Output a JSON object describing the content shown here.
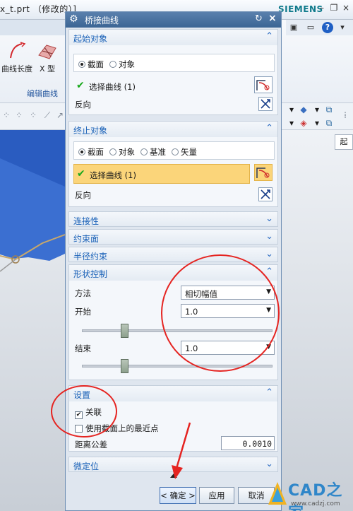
{
  "window": {
    "file_title": "x_t.prt （修改的）]",
    "brand": "SIEMENS",
    "minimize": "–",
    "restore": "❐",
    "close": "×"
  },
  "ribbon": {
    "tool1_label": "曲线长度",
    "tool2_label": "X 型",
    "group_label": "编辑曲线"
  },
  "side_tab_label": "起",
  "dialog": {
    "title": "桥接曲线",
    "start_section": {
      "title": "起始对象",
      "radio_options": [
        "截面",
        "对象"
      ],
      "radio_selected": "截面",
      "select_curve_label": "选择曲线 (1)",
      "reverse_label": "反向"
    },
    "end_section": {
      "title": "终止对象",
      "radio_options": [
        "截面",
        "对象",
        "基准",
        "矢量"
      ],
      "radio_selected": "截面",
      "select_curve_label": "选择曲线 (1)",
      "reverse_label": "反向"
    },
    "continuity_title": "连接性",
    "constraint_face_title": "约束面",
    "radius_constraint_title": "半径约束",
    "shape_control": {
      "title": "形状控制",
      "method_label": "方法",
      "method_value": "相切幅值",
      "start_label": "开始",
      "start_value": "1.0",
      "start_slider_fraction": 0.2,
      "end_label": "结束",
      "end_value": "1.0",
      "end_slider_fraction": 0.2
    },
    "settings": {
      "title": "设置",
      "associative_label": "关联",
      "associative_checked": true,
      "nearest_point_label": "使用截面上的最近点",
      "nearest_point_checked": false,
      "distance_tolerance_label": "距离公差",
      "distance_tolerance_value": "0.0010"
    },
    "fine_positioning_title": "微定位",
    "buttons": {
      "ok": "< 确定 >",
      "apply": "应用",
      "cancel": "取消"
    }
  },
  "watermark": {
    "brand": "CAD之家",
    "url": "www.cadzj.com"
  },
  "colors": {
    "dialog_title_bar": "#3b6594",
    "section_title_text": "#1b62b8",
    "highlight_row": "#fbd57a",
    "annotation_red": "#e52421",
    "brand_teal": "#0f7a8b"
  }
}
